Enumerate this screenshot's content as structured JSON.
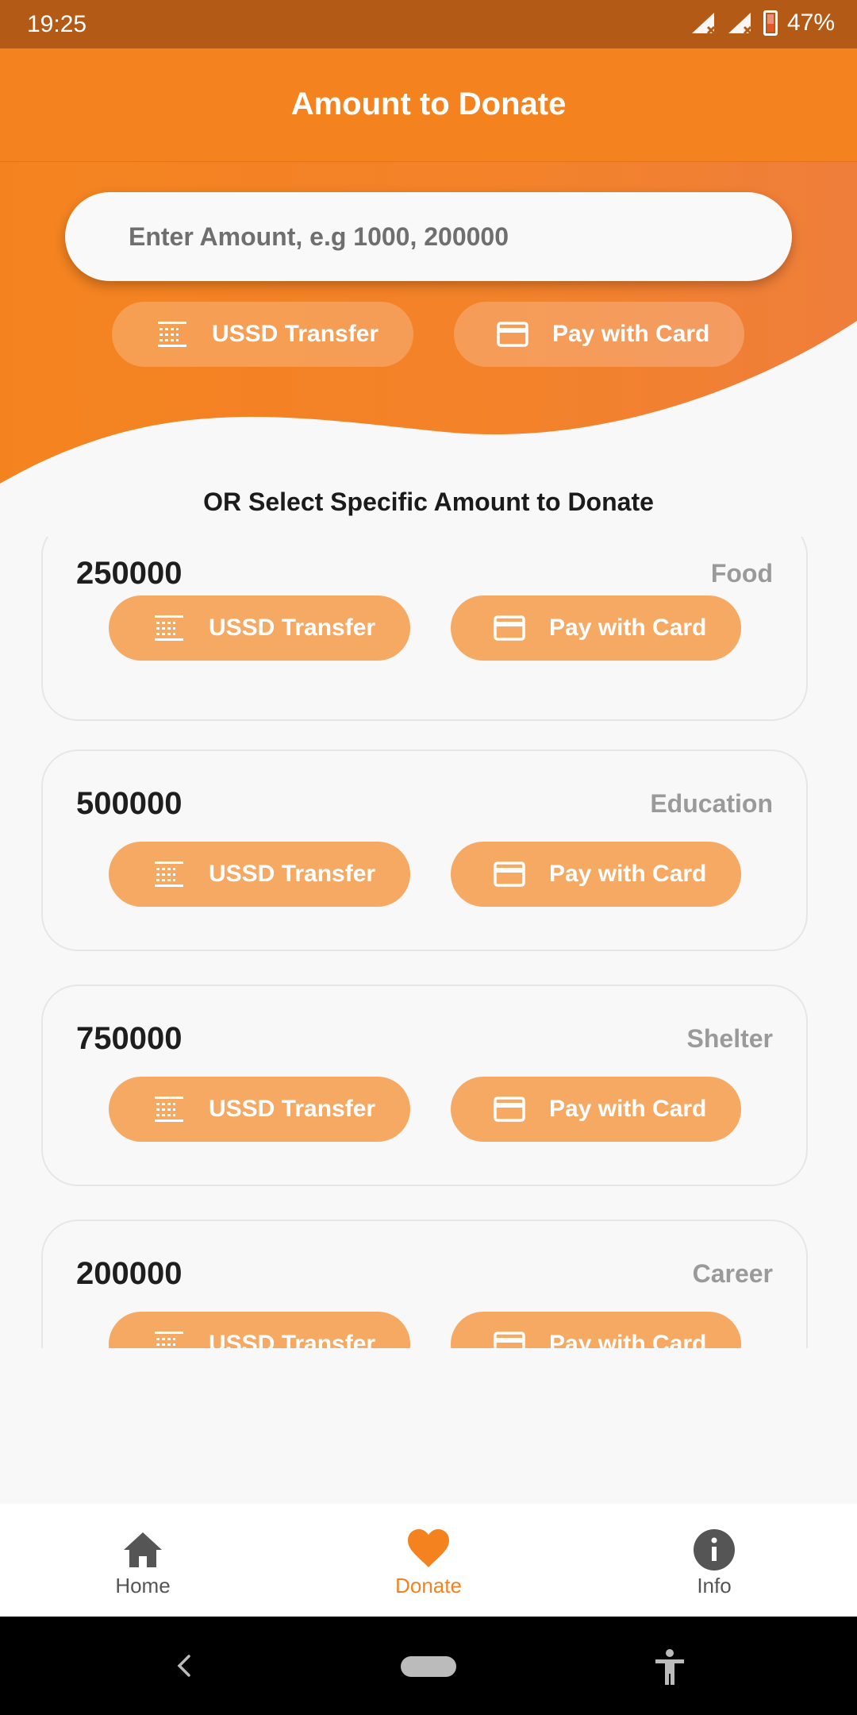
{
  "status_bar": {
    "time": "19:25",
    "battery": "47%"
  },
  "header": {
    "title": "Amount to Donate"
  },
  "amount_input": {
    "placeholder": "Enter Amount, e.g 1000, 200000"
  },
  "top_actions": {
    "ussd_label": "USSD Transfer",
    "card_label": "Pay with Card"
  },
  "section_caption": "OR Select Specific Amount to Donate",
  "cards": [
    {
      "amount": "250000",
      "category": "Food",
      "ussd_label": "USSD Transfer",
      "card_label": "Pay with Card"
    },
    {
      "amount": "500000",
      "category": "Education",
      "ussd_label": "USSD Transfer",
      "card_label": "Pay with Card"
    },
    {
      "amount": "750000",
      "category": "Shelter",
      "ussd_label": "USSD Transfer",
      "card_label": "Pay with Card"
    },
    {
      "amount": "200000",
      "category": "Career",
      "ussd_label": "USSD Transfer",
      "card_label": "Pay with Card"
    }
  ],
  "bottom_nav": {
    "home": "Home",
    "donate": "Donate",
    "info": "Info",
    "active": "donate"
  },
  "colors": {
    "accent": "#f4821f",
    "button": "#f5a963",
    "status_bar": "#b35a17",
    "active_nav": "#f4821f",
    "inactive_nav": "#555555"
  },
  "icons": [
    "signal-icon",
    "battery-icon",
    "ussd-icon",
    "credit-card-icon",
    "home-icon",
    "heart-icon",
    "info-icon",
    "back-icon",
    "home-pill-icon",
    "accessibility-icon"
  ]
}
